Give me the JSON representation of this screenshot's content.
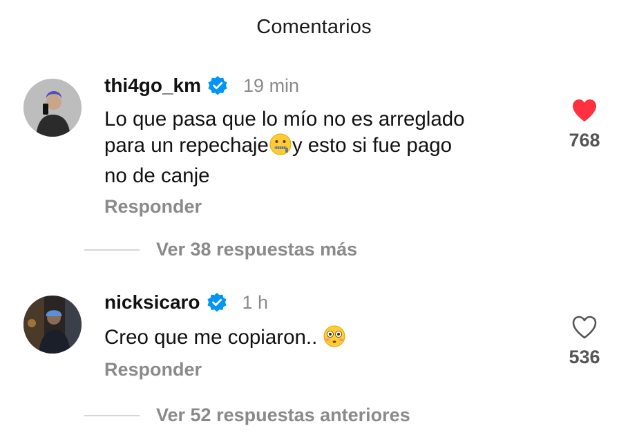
{
  "header": {
    "title": "Comentarios"
  },
  "comments": [
    {
      "username": "thi4go_km",
      "time": "19 min",
      "text_line1": "Lo que pasa que lo mío no es arreglado",
      "text_line2a": "para un repechaje",
      "text_line2b": "y esto si fue pago",
      "text_line3": "no de canje",
      "emoji": "zipper-mouth-face",
      "reply_label": "Responder",
      "likes": "768",
      "liked": true,
      "view_replies": "Ver 38 respuestas más"
    },
    {
      "username": "nicksicaro",
      "time": "1 h",
      "text": "Creo que me copiaron.. ",
      "emoji": "flushed-face",
      "reply_label": "Responder",
      "likes": "536",
      "liked": false,
      "view_replies": "Ver 52 respuestas anteriores"
    }
  ],
  "colors": {
    "heart_liked": "#ff3040",
    "verified": "#0095f6",
    "muted": "#8a8a8a"
  }
}
